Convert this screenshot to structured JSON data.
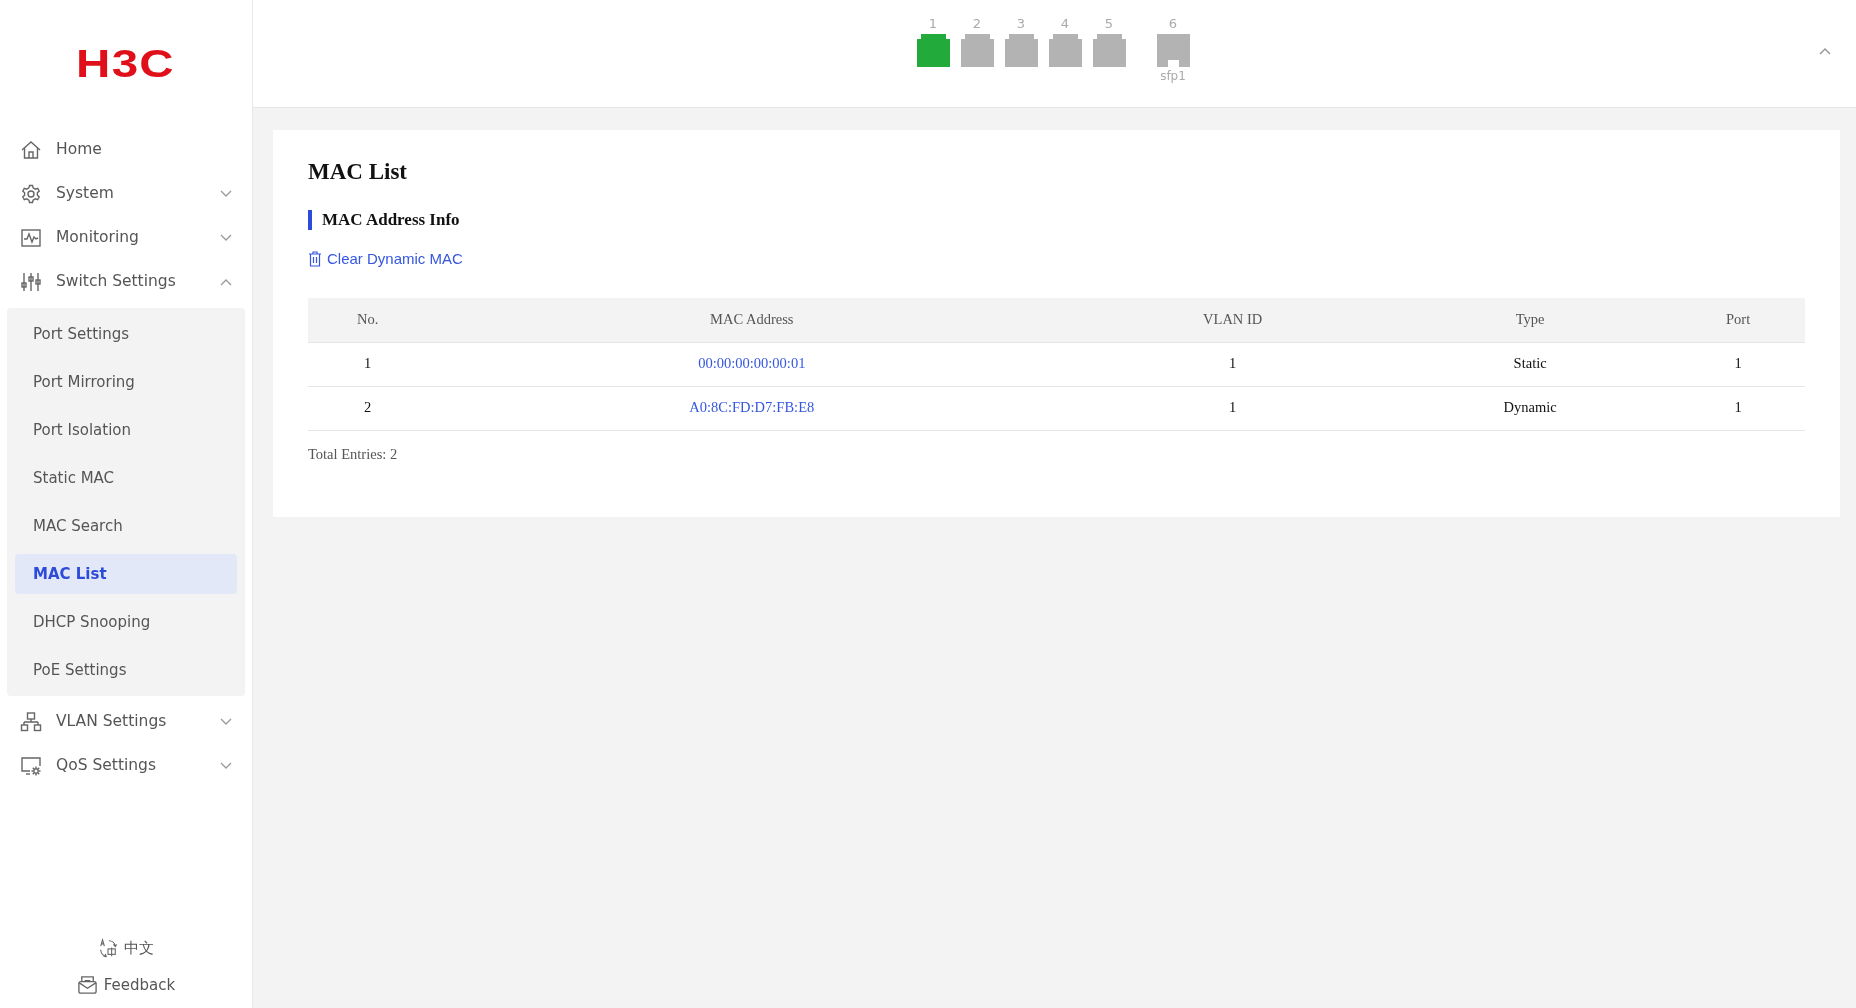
{
  "logo": "H3C",
  "sidebar": {
    "items": [
      {
        "label": "Home"
      },
      {
        "label": "System",
        "expanded": false
      },
      {
        "label": "Monitoring",
        "expanded": false
      },
      {
        "label": "Switch Settings",
        "expanded": true,
        "children": [
          {
            "label": "Port Settings",
            "selected": false
          },
          {
            "label": "Port Mirroring",
            "selected": false
          },
          {
            "label": "Port Isolation",
            "selected": false
          },
          {
            "label": "Static MAC",
            "selected": false
          },
          {
            "label": "MAC Search",
            "selected": false
          },
          {
            "label": "MAC List",
            "selected": true
          },
          {
            "label": "DHCP Snooping",
            "selected": false
          },
          {
            "label": "PoE Settings",
            "selected": false
          }
        ]
      },
      {
        "label": "VLAN Settings",
        "expanded": false
      },
      {
        "label": "QoS Settings",
        "expanded": false
      }
    ],
    "language": "中文",
    "feedback": "Feedback"
  },
  "ports": [
    {
      "number": "1",
      "kind": "rj45",
      "up": true
    },
    {
      "number": "2",
      "kind": "rj45",
      "up": false
    },
    {
      "number": "3",
      "kind": "rj45",
      "up": false
    },
    {
      "number": "4",
      "kind": "rj45",
      "up": false
    },
    {
      "number": "5",
      "kind": "rj45",
      "up": false
    },
    {
      "number": "6",
      "kind": "sfp",
      "up": false,
      "caption": "sfp1"
    }
  ],
  "page_title": "MAC List",
  "section_title": "MAC Address Info",
  "clear_button": "Clear Dynamic MAC",
  "table": {
    "columns": [
      "No.",
      "MAC Address",
      "VLAN ID",
      "Type",
      "Port"
    ],
    "rows": [
      [
        "1",
        "00:00:00:00:00:01",
        "1",
        "Static",
        "1"
      ],
      [
        "2",
        "A0:8C:FD:D7:FB:E8",
        "1",
        "Dynamic",
        "1"
      ]
    ]
  },
  "total": "Total Entries: 2"
}
